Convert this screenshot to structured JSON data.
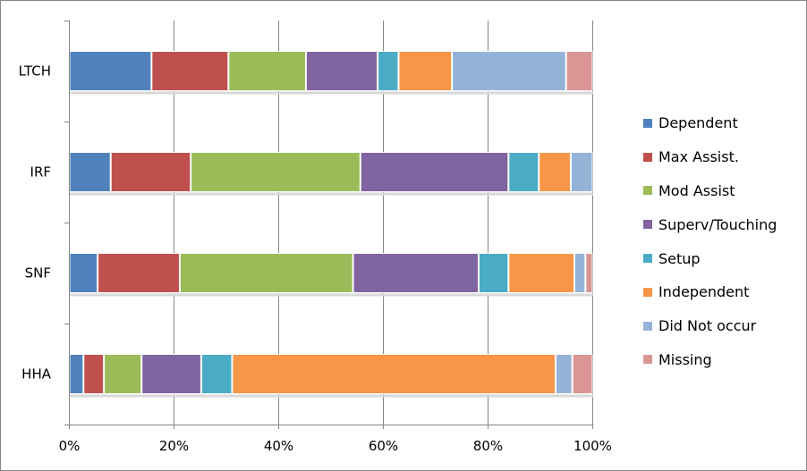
{
  "chart_data": {
    "type": "bar",
    "orientation": "horizontal",
    "stacked": "percent",
    "title": "",
    "xlabel": "",
    "ylabel": "",
    "xlim": [
      0,
      100
    ],
    "x_ticks": [
      "0%",
      "20%",
      "40%",
      "60%",
      "80%",
      "100%"
    ],
    "grid": "vertical major gridlines",
    "legend_position": "right",
    "categories": [
      "LTCH",
      "IRF",
      "SNF",
      "HHA"
    ],
    "series": [
      {
        "name": "Dependent",
        "color": "#4F81BD",
        "values": [
          15.7,
          7.9,
          5.4,
          2.7
        ]
      },
      {
        "name": "Max Assist.",
        "color": "#C0504D",
        "values": [
          14.7,
          15.3,
          15.7,
          3.9
        ]
      },
      {
        "name": "Mod Assist",
        "color": "#9BBB59",
        "values": [
          14.8,
          32.4,
          33.1,
          7.2
        ]
      },
      {
        "name": "Superv/Touching",
        "color": "#8064A2",
        "values": [
          13.7,
          28.3,
          24.0,
          11.4
        ]
      },
      {
        "name": "Setup",
        "color": "#4BACC6",
        "values": [
          4.0,
          5.8,
          5.7,
          5.9
        ]
      },
      {
        "name": "Independent",
        "color": "#F79646",
        "values": [
          10.2,
          6.1,
          12.6,
          61.8
        ]
      },
      {
        "name": "Did Not occur",
        "color": "#95B3D7",
        "values": [
          21.8,
          4.2,
          2.1,
          3.2
        ]
      },
      {
        "name": "Missing",
        "color": "#D99694",
        "values": [
          5.1,
          0.0,
          1.4,
          3.9
        ]
      }
    ]
  }
}
